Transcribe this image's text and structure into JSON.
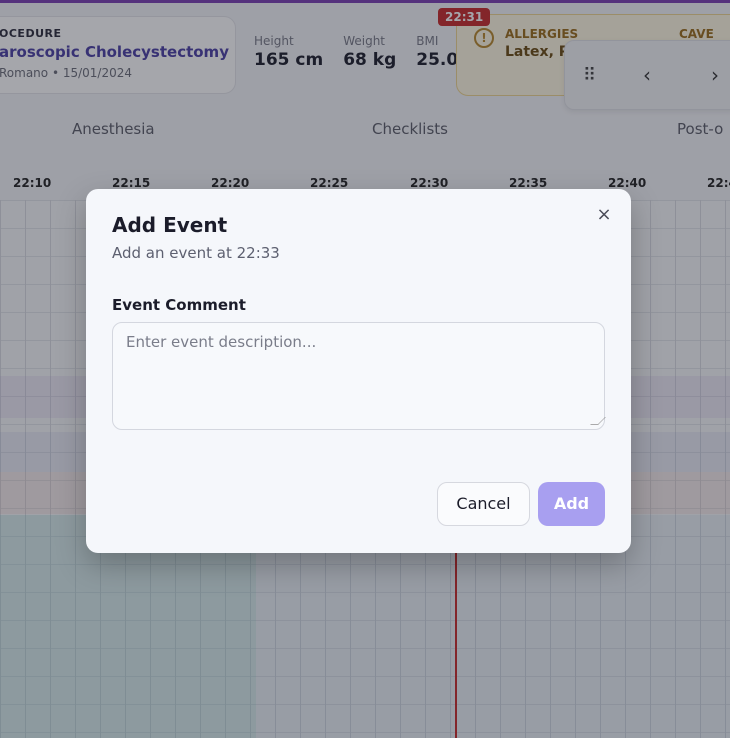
{
  "header": {
    "procedure_label": "OCEDURE",
    "procedure_name": "aroscopic Cholecystectomy",
    "procedure_meta": "Romano • 15/01/2024",
    "height_label": "Height",
    "height_value": "165 cm",
    "weight_label": "Weight",
    "weight_value": "68 kg",
    "bmi_label": "BMI",
    "bmi_value": "25.0",
    "allergies_label": "ALLERGIES",
    "allergies_value": "Latex, P",
    "cave_label": "CAVE",
    "current_time": "22:31"
  },
  "nav": {
    "drag_icon": "⠿",
    "prev_icon": "‹",
    "next_icon": "›"
  },
  "sections": [
    "Anesthesia",
    "Checklists",
    "Post-o"
  ],
  "timeline": {
    "ticks": [
      "22:10",
      "22:15",
      "22:20",
      "22:25",
      "22:30",
      "22:35",
      "22:40",
      "22:4"
    ]
  },
  "modal": {
    "title": "Add Event",
    "subtitle": "Add an event at 22:33",
    "close_icon": "×",
    "field_label": "Event Comment",
    "field_placeholder": "Enter event description...",
    "field_value": "",
    "cancel_label": "Cancel",
    "add_label": "Add"
  },
  "colors": {
    "accent": "#7b3fb3",
    "now_line": "#c62828",
    "add_button": "#a89ff0",
    "allergy_bg": "#fff8e1"
  }
}
